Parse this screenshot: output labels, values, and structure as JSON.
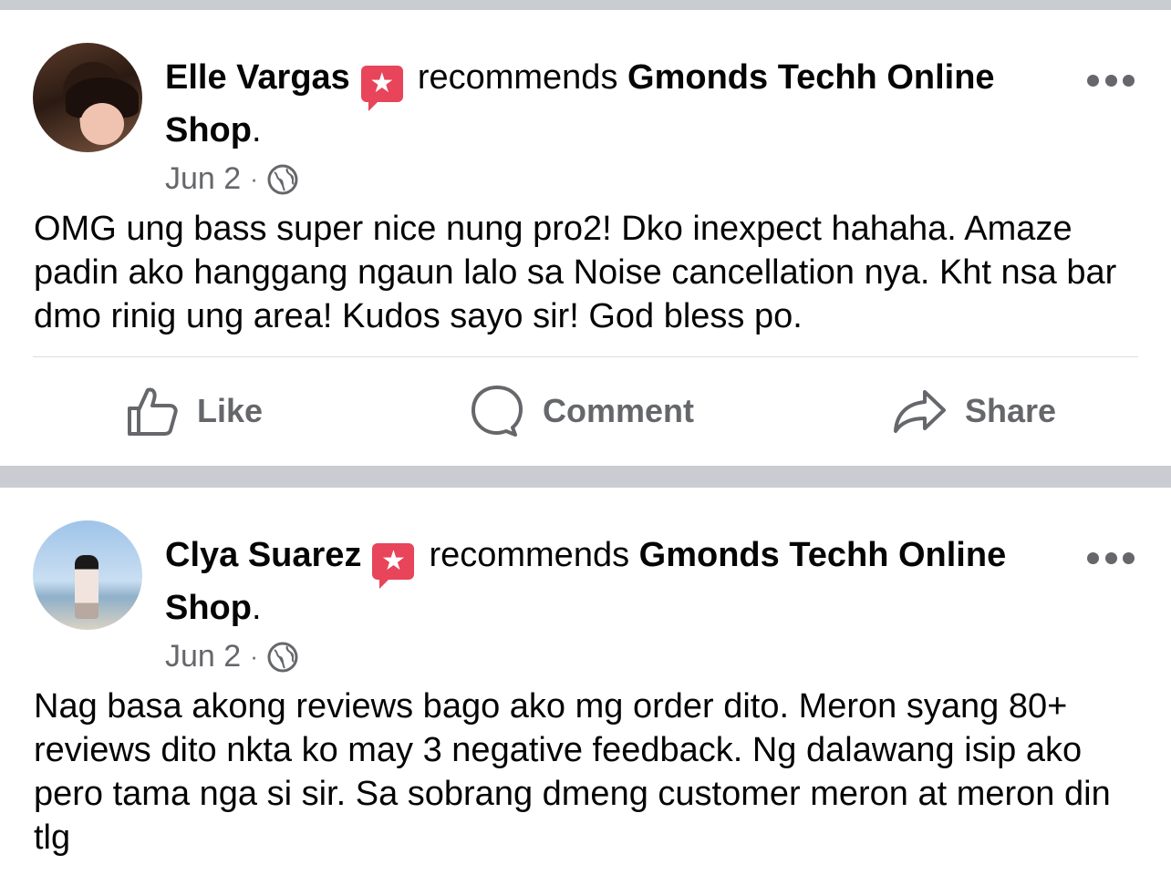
{
  "posts": [
    {
      "author": "Elle Vargas",
      "verb": "recommends",
      "page": "Gmonds Techh Online",
      "page_cont": "Shop",
      "date": "Jun 2",
      "separator": "·",
      "text": "OMG ung bass super nice nung pro2! Dko inexpect hahaha. Amaze padin ako hanggang ngaun lalo sa Noise cancellation nya. Kht nsa bar dmo rinig ung area! Kudos sayo sir! God bless po.",
      "actions": {
        "like": "Like",
        "comment": "Comment",
        "share": "Share"
      }
    },
    {
      "author": "Clya Suarez",
      "verb": "recommends",
      "page": "Gmonds Techh Online",
      "page_cont": "Shop",
      "date": "Jun 2",
      "separator": "·",
      "text": "Nag basa akong reviews bago ako mg order dito. Meron syang 80+ reviews dito nkta ko may 3 negative feedback. Ng dalawang isip ako pero tama nga si sir. Sa sobrang dmeng customer meron at meron din tlg"
    }
  ],
  "icons": {
    "badge": "recommend-star-badge-icon",
    "more": "more-options-icon",
    "globe": "globe-icon",
    "like": "thumbs-up-icon",
    "comment": "comment-bubble-icon",
    "share": "share-arrow-icon"
  },
  "colors": {
    "badge": "#e8445a",
    "secondary_text": "#65676b",
    "divider": "#c9ccd1"
  }
}
